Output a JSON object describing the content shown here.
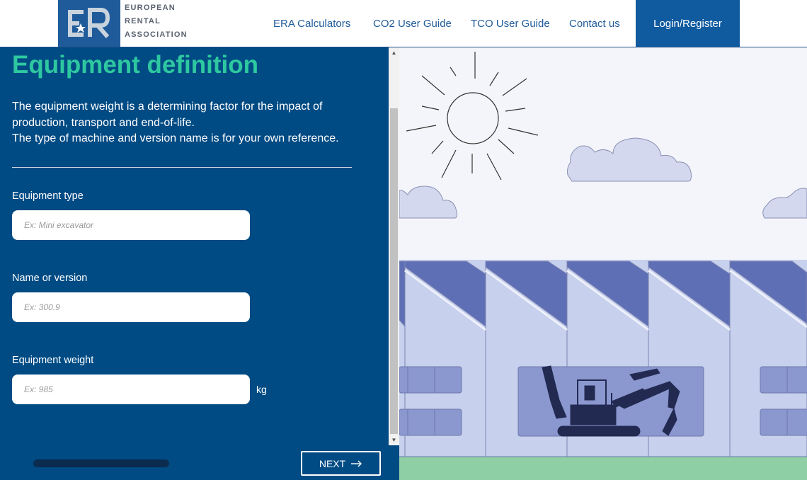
{
  "header": {
    "logo_lines": [
      "EUROPEAN",
      "RENTAL",
      "ASSOCIATION"
    ],
    "nav": [
      {
        "label": "ERA Calculators"
      },
      {
        "label": "CO2 User Guide"
      },
      {
        "label": "TCO User Guide"
      },
      {
        "label": "Contact us"
      }
    ],
    "login_label": "Login/Register"
  },
  "form": {
    "title": "Equipment definition",
    "description_line1": "The equipment weight is a determining factor for the impact of production, transport and end-of-life.",
    "description_line2": "The type of machine and version name is for your own reference.",
    "fields": [
      {
        "label": "Equipment type",
        "placeholder": "Ex: Mini excavator",
        "value": ""
      },
      {
        "label": "Name or version",
        "placeholder": "Ex: 300.9",
        "value": ""
      },
      {
        "label": "Equipment weight",
        "placeholder": "Ex: 985",
        "value": "",
        "unit": "kg"
      }
    ],
    "next_label": "NEXT"
  },
  "colors": {
    "panel": "#004b84",
    "title": "#2ec8a0",
    "brand": "#105aa0"
  }
}
